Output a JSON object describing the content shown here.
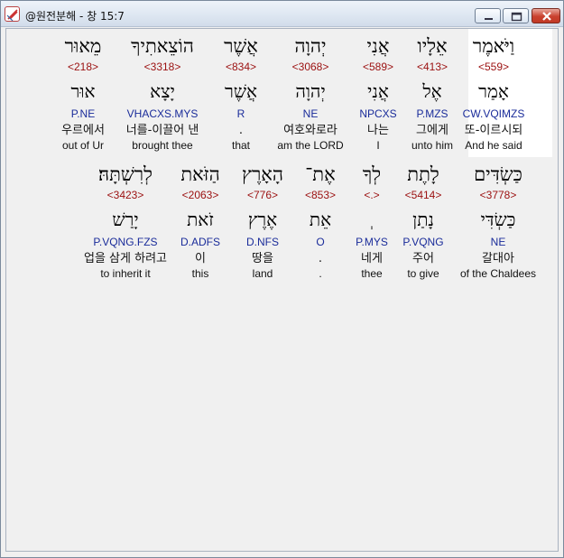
{
  "window": {
    "title": "@원전분해 - 창 15:7",
    "icon": "bible-app-icon",
    "controls": [
      "minimize",
      "maximize",
      "close"
    ]
  },
  "rows": [
    {
      "words": [
        {
          "heb": "וַיֹּאמֶר",
          "strong": "<559>",
          "lemma": "אָמַר",
          "morph": "CW.VQIMZS",
          "kor": "또-이르시되",
          "eng": "And he said",
          "selected": true
        },
        {
          "heb": "אֵלָיו",
          "strong": "<413>",
          "lemma": "אֶל",
          "morph": "P.MZS",
          "kor": "그에게",
          "eng": "unto him"
        },
        {
          "heb": "אֲנִי",
          "strong": "<589>",
          "lemma": "אֲנִי",
          "morph": "NPCXS",
          "kor": "나는",
          "eng": "I"
        },
        {
          "heb": "יְהוָה",
          "strong": "<3068>",
          "lemma": "יְהוָה",
          "morph": "NE",
          "kor": "여호와로라",
          "eng": "am the LORD"
        },
        {
          "heb": "אֲשֶׁר",
          "strong": "<834>",
          "lemma": "אֲשֶׁר",
          "morph": "R",
          "kor": ".",
          "eng": "that"
        },
        {
          "heb": "הוֹצֵאתִיךָ",
          "strong": "<3318>",
          "lemma": "יָצָא",
          "morph": "VHACXS.MYS",
          "kor": "너를-이끌어 낸",
          "eng": "brought thee"
        },
        {
          "heb": "מֵאוּר",
          "strong": "<218>",
          "lemma": "אוּר",
          "morph": "P.NE",
          "kor": "우르에서",
          "eng": "out of Ur"
        }
      ]
    },
    {
      "words": [
        {
          "heb": "כַּשְׂדִּים",
          "strong": "<3778>",
          "lemma": "כַּשְׂדִּי",
          "morph": "NE",
          "kor": "갈대아",
          "eng": "of the Chaldees"
        },
        {
          "heb": "לָתֶת",
          "strong": "<5414>",
          "lemma": "נָתַן",
          "morph": "P.VQNG",
          "kor": "주어",
          "eng": "to give"
        },
        {
          "heb": "לְךָ",
          "strong": "<.>",
          "lemma": "ְ",
          "morph": "P.MYS",
          "kor": "네게",
          "eng": "thee"
        },
        {
          "heb": "אֶת־",
          "strong": "<853>",
          "lemma": "אֵת",
          "morph": "O",
          "kor": ".",
          "eng": "."
        },
        {
          "heb": "הָאָרֶץ",
          "strong": "<776>",
          "lemma": "אֶרֶץ",
          "morph": "D.NFS",
          "kor": "땅을",
          "eng": "land"
        },
        {
          "heb": "הַזֹּאת",
          "strong": "<2063>",
          "lemma": "זֹאת",
          "morph": "D.ADFS",
          "kor": "이",
          "eng": "this"
        },
        {
          "heb": "לְרִשְׁתָּהּ׃",
          "strong": "<3423>",
          "lemma": "יָרַשׁ",
          "morph": "P.VQNG.FZS",
          "kor": "업을 삼게 하려고",
          "eng": "to inherit it"
        }
      ]
    }
  ]
}
